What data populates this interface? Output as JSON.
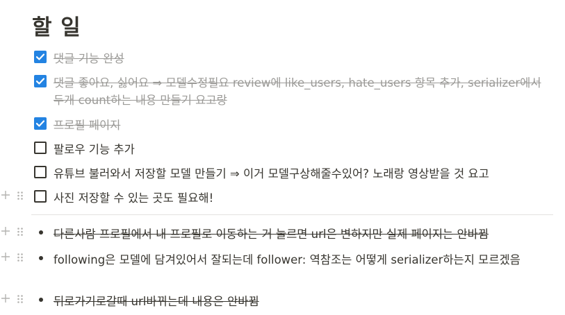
{
  "page": {
    "title": "할 일"
  },
  "todos": [
    {
      "label": "댓글 기능 완성",
      "checked": true
    },
    {
      "label": "댓글 좋아요, 싫어요 ⇒ 모델수정필요 review에 like_users, hate_users 항목 추가, serializer에서 두개 count하는 내용 만들기 요고랑",
      "checked": true
    },
    {
      "label": "프로필 페이지",
      "checked": true
    },
    {
      "label": "팔로우 기능 추가",
      "checked": false
    },
    {
      "label": "유튜브 불러와서 저장할 모델 만들기 ⇒ 이거 모델구상해줄수있어? 노래랑 영상받을 것 요고",
      "checked": false
    },
    {
      "label": "사진 저장할 수 있는 곳도 필요해!",
      "checked": false
    }
  ],
  "bullets": [
    {
      "label": "다른사람 프로필에서 내 프로필로 이동하는 거 눌르면 url은 변하지만 실제 페이지는 안바뀜",
      "strikethrough": true
    },
    {
      "label": "following은 모델에 담겨있어서 잘되는데 follower: 역참조는 어떻게 serializer하는지 모르겠음",
      "strikethrough": false
    },
    {
      "label": "뒤로가기로갈때 url바뀌는데 내용은 안바뀜",
      "strikethrough": true
    }
  ],
  "colors": {
    "checkbox_checked": "#2383e2",
    "text": "#37352f",
    "text_done": "#9b9a97",
    "divider": "#e3e2e0"
  }
}
